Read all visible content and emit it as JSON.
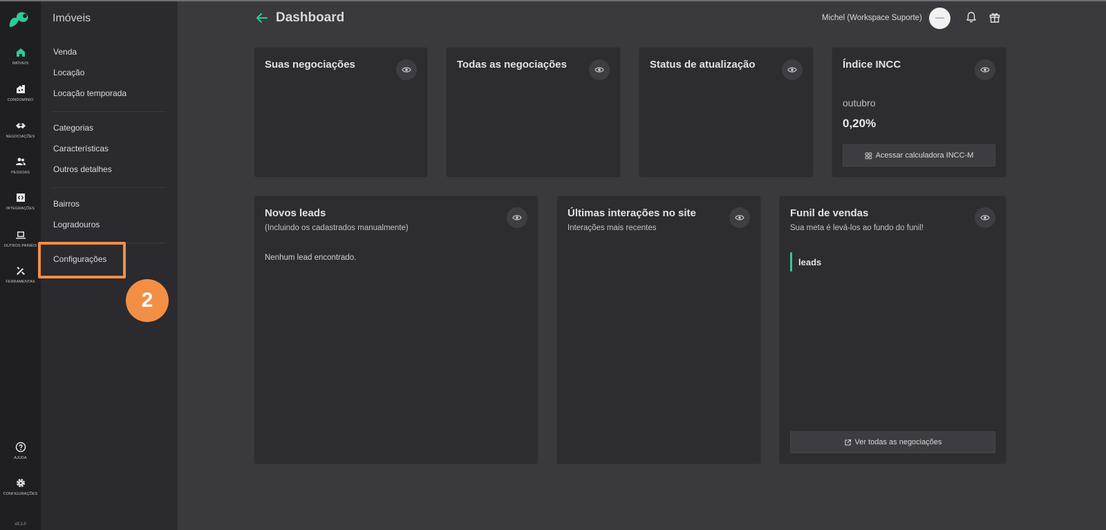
{
  "rail": {
    "items": [
      {
        "label": "IMÓVEIS",
        "icon": "home-icon"
      },
      {
        "label": "CONDOMÍNIO",
        "icon": "building-icon"
      },
      {
        "label": "NEGOCIAÇÕES",
        "icon": "handshake-icon"
      },
      {
        "label": "PESSOAS",
        "icon": "people-icon"
      },
      {
        "label": "INTEGRAÇÕES",
        "icon": "integration-icon"
      },
      {
        "label": "OUTROS PAINÉIS",
        "icon": "laptop-icon"
      },
      {
        "label": "FERRAMENTAS",
        "icon": "tools-icon"
      }
    ],
    "help_label": "AJUDA",
    "settings_label": "CONFIGURAÇÕES",
    "version": "v3.1.0"
  },
  "submenu": {
    "title": "Imóveis",
    "items": [
      "Venda",
      "Locação",
      "Locação temporada",
      "Categorias",
      "Características",
      "Outros detalhes",
      "Bairros",
      "Logradouros",
      "Configurações"
    ]
  },
  "annotation": {
    "step": "2",
    "color": "#f28f45"
  },
  "header": {
    "title": "Dashboard",
    "user": "Michel (Workspace Suporte)"
  },
  "cards": {
    "suas": {
      "title": "Suas negociações"
    },
    "todas": {
      "title": "Todas as negociações"
    },
    "status": {
      "title": "Status de atualização"
    },
    "incc": {
      "title": "Índice INCC",
      "month": "outubro",
      "value": "0,20%",
      "button": "Acessar calculadora INCC-M"
    },
    "leads": {
      "title": "Novos leads",
      "subtitle": "(Incluindo os cadastrados manualmente)",
      "empty": "Nenhum lead encontrado."
    },
    "interacoes": {
      "title": "Últimas interações no site",
      "subtitle": "Interações mais recentes"
    },
    "funil": {
      "title": "Funil de vendas",
      "subtitle": "Sua meta é levá-los ao fundo do funil!",
      "stage": "leads",
      "button": "Ver todas as negociações"
    }
  },
  "colors": {
    "accent": "#2fc995",
    "background": "#3a393e",
    "card": "#2d2c31",
    "highlight": "#f28f45"
  }
}
